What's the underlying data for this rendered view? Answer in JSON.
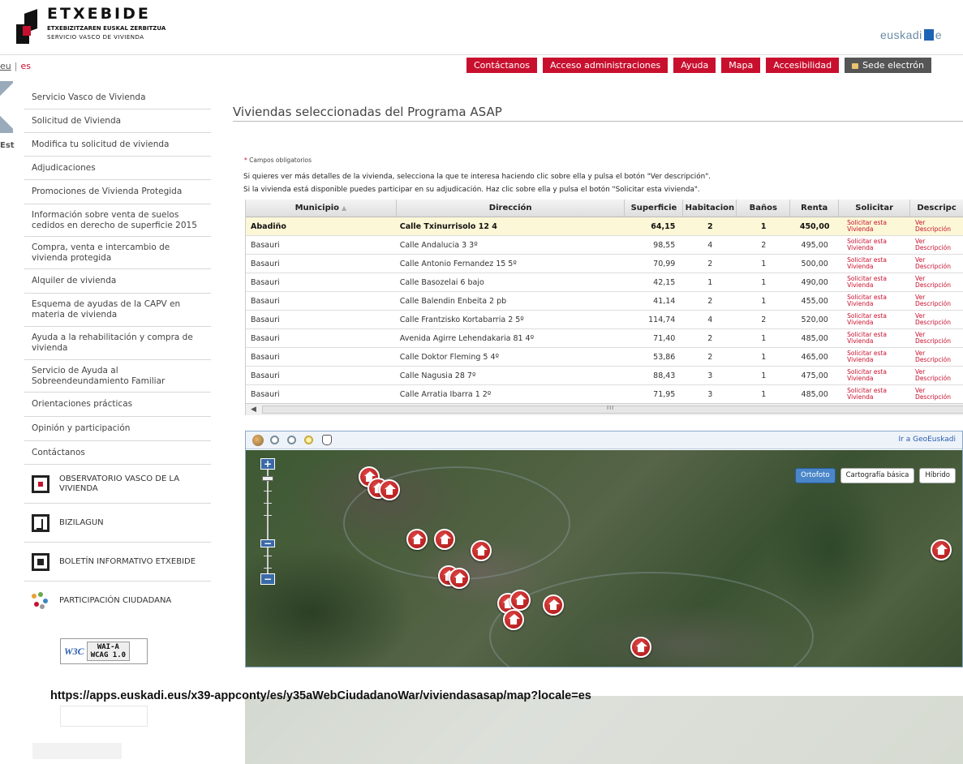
{
  "header": {
    "logo_name": "ETXEBIDE",
    "logo_line1": "ETXEBIZITZAREN EUSKAL ZERBITZUA",
    "logo_line2": "SERVICIO VASCO DE VIVIENDA",
    "brand_right": "euskadi",
    "brand_right_tail": "e",
    "lang_eu": "eu",
    "lang_es": "es",
    "nav": [
      "Contáctanos",
      "Acceso administraciones",
      "Ayuda",
      "Mapa",
      "Accesibilidad",
      "Sede electrón"
    ],
    "accent": "#c8102e",
    "left_fragment": "Est"
  },
  "sidebar": {
    "items": [
      "Servicio Vasco de Vivienda",
      "Solicitud de Vivienda",
      "Modifica tu solicitud de vivienda",
      "Adjudicaciones",
      "Promociones de Vivienda Protegida",
      "Información sobre venta de suelos cedidos en derecho de superficie 2015",
      "Compra, venta e intercambio de vivienda protegida",
      "Alquiler de vivienda",
      "Esquema de ayudas de la CAPV en materia de vivienda",
      "Ayuda a la rehabilitación y compra de vivienda",
      "Servicio de Ayuda al Sobreendeundamiento Familiar",
      "Orientaciones prácticas",
      "Opinión y participación",
      "Contáctanos"
    ],
    "boxes": [
      {
        "label": "OBSERVATORIO VASCO DE LA VIVIENDA",
        "icon": "observatorio-icon"
      },
      {
        "label": "BIZILAGUN",
        "icon": "bizilagun-icon"
      },
      {
        "label": "BOLETÍN INFORMATIVO ETXEBIDE",
        "icon": "boletin-icon"
      },
      {
        "label": "PARTICIPACIÓN CIUDADANA",
        "icon": "participacion-icon"
      }
    ],
    "badge_w3c": "W3C",
    "badge_wai": "WAI-A",
    "badge_wcag": "WCAG 1.0"
  },
  "main": {
    "title": "Viviendas seleccionadas del Programa ASAP",
    "required_note": "Campos obligatorios",
    "info_line1": "Si quieres ver más detalles de la vivienda, selecciona la que te interesa haciendo clic sobre ella y pulsa el botón \"Ver descripción\".",
    "info_line2": "Si la vivienda está disponible puedes participar en su adjudicación. Haz clic sobre ella y pulsa el botón \"Solicitar esta vivienda\"."
  },
  "table": {
    "columns": [
      "Municipio",
      "Dirección",
      "Superficie",
      "Habitacion",
      "Baños",
      "Renta",
      "Solicitar",
      "Descripc"
    ],
    "solicitar_label": "Solicitar esta Vivienda",
    "ver_label": "Ver Descripción",
    "selected_row": 0,
    "rows": [
      [
        "Abadiño",
        "Calle Txinurrisolo 12 4",
        "64,15",
        "2",
        "1",
        "450,00"
      ],
      [
        "Basauri",
        "Calle Andalucia 3 3º",
        "98,55",
        "4",
        "2",
        "495,00"
      ],
      [
        "Basauri",
        "Calle Antonio Fernandez 15 5º",
        "70,99",
        "2",
        "1",
        "500,00"
      ],
      [
        "Basauri",
        "Calle Basozelai 6 bajo",
        "42,15",
        "1",
        "1",
        "490,00"
      ],
      [
        "Basauri",
        "Calle Balendin Enbeita 2 pb",
        "41,14",
        "2",
        "1",
        "455,00"
      ],
      [
        "Basauri",
        "Calle Frantzisko Kortabarria 2 5º",
        "114,74",
        "4",
        "2",
        "520,00"
      ],
      [
        "Basauri",
        "Avenida Agirre Lehendakaria 81 4º",
        "71,40",
        "2",
        "1",
        "485,00"
      ],
      [
        "Basauri",
        "Calle Doktor Fleming 5 4º",
        "53,86",
        "2",
        "1",
        "465,00"
      ],
      [
        "Basauri",
        "Calle Nagusia 28 7º",
        "88,43",
        "3",
        "1",
        "475,00"
      ],
      [
        "Basauri",
        "Calle Arratia Ibarra 1 2º",
        "71,95",
        "3",
        "1",
        "485,00"
      ]
    ],
    "scroll_grip": "III"
  },
  "map": {
    "geo_link": "Ir a GeoEuskadi",
    "layers": [
      "Ortofoto",
      "Cartografía básica",
      "Híbrido"
    ],
    "active_layer": "Ortofoto",
    "zoom_in": "+",
    "zoom_out": "−"
  },
  "caption": "https://apps.euskadi.eus/x39-appconty/es/y35aWebCiudadanoWar/viviendasasap/map?locale=es"
}
